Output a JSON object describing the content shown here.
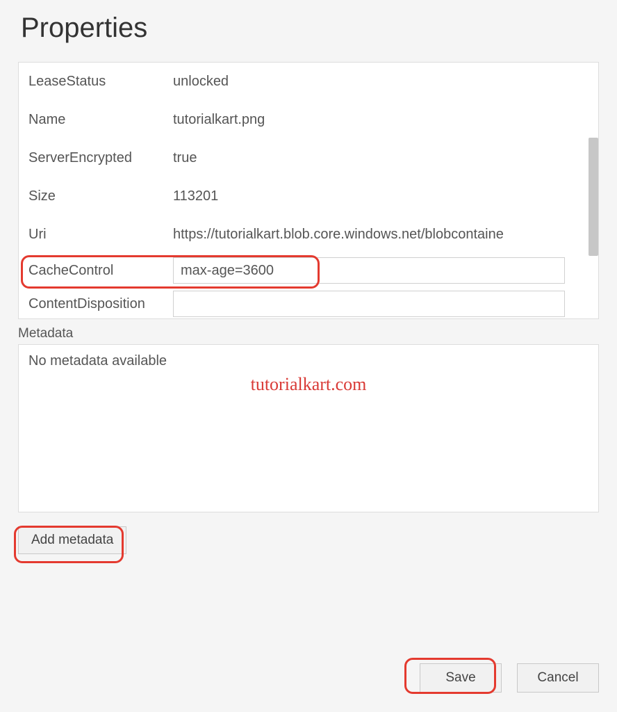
{
  "title": "Properties",
  "properties": [
    {
      "label": "LeaseStatus",
      "value": "unlocked"
    },
    {
      "label": "Name",
      "value": "tutorialkart.png"
    },
    {
      "label": "ServerEncrypted",
      "value": "true"
    },
    {
      "label": "Size",
      "value": "113201"
    },
    {
      "label": "Uri",
      "value": "https://tutorialkart.blob.core.windows.net/blobcontaine"
    }
  ],
  "editable": {
    "cacheControl": {
      "label": "CacheControl",
      "value": "max-age=3600"
    },
    "contentDisposition": {
      "label": "ContentDisposition",
      "value": ""
    }
  },
  "metadata": {
    "section_label": "Metadata",
    "empty_text": "No metadata available",
    "add_button": "Add metadata"
  },
  "footer": {
    "save": "Save",
    "cancel": "Cancel"
  },
  "watermark": "tutorialkart.com"
}
